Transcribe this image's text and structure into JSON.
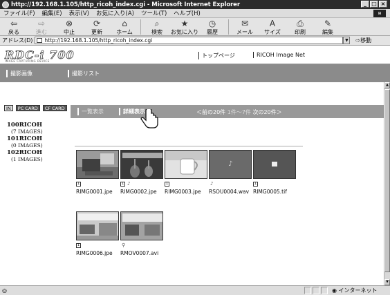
{
  "window": {
    "title": "http://192.168.1.105/http_ricoh_index.cgi - Microsoft Internet Explorer",
    "controls": [
      "_",
      "□",
      "×"
    ]
  },
  "menubar": {
    "items": [
      "ファイル(F)",
      "編集(E)",
      "表示(V)",
      "お気に入り(A)",
      "ツール(T)",
      "ヘルプ(H)"
    ]
  },
  "toolbar": {
    "buttons": [
      {
        "label": "戻る",
        "icon": "back-arrow-icon",
        "glyph": "⇦"
      },
      {
        "label": "進む",
        "icon": "forward-arrow-icon",
        "glyph": "⇨"
      },
      {
        "label": "中止",
        "icon": "stop-icon",
        "glyph": "⊗"
      },
      {
        "label": "更新",
        "icon": "refresh-icon",
        "glyph": "⟳"
      },
      {
        "label": "ホーム",
        "icon": "home-icon",
        "glyph": "⌂"
      },
      {
        "label": "検索",
        "icon": "search-icon",
        "glyph": "⌕"
      },
      {
        "label": "お気に入り",
        "icon": "favorites-icon",
        "glyph": "★"
      },
      {
        "label": "履歴",
        "icon": "history-icon",
        "glyph": "◷"
      },
      {
        "label": "メール",
        "icon": "mail-icon",
        "glyph": "✉"
      },
      {
        "label": "サイズ",
        "icon": "font-size-icon",
        "glyph": "A"
      },
      {
        "label": "印刷",
        "icon": "print-icon",
        "glyph": "⎙"
      },
      {
        "label": "編集",
        "icon": "edit-icon",
        "glyph": "✎"
      }
    ]
  },
  "addressbar": {
    "label": "アドレス(D)",
    "url": "http://192.168.1.105/http_ricoh_index.cgi",
    "go_label": "⇨移動"
  },
  "header": {
    "logo": "RDC-i 700",
    "logo_sub": "IMAGE CAPTURING DEVICE",
    "links": [
      "トップページ",
      "RICOH Image Net"
    ],
    "tabs": [
      "撮影画像",
      "撮影リスト"
    ]
  },
  "sidebar": {
    "modes": [
      "IN",
      "PC CARD",
      "CF CARD"
    ],
    "folders": [
      {
        "name": "100RICOH",
        "count": "(7 IMAGES)"
      },
      {
        "name": "101RICOH",
        "count": "(0 IMAGES)"
      },
      {
        "name": "102RICOH",
        "count": "(1 IMAGES)"
      }
    ]
  },
  "main": {
    "view_list": "一覧表示",
    "view_detail": "詳細表示",
    "nav_prev": "＜前の20件",
    "nav_range": "1件〜7件",
    "nav_next": "次の20件＞",
    "thumbnails": [
      {
        "file": "RIMG0001.jpe",
        "type": "photo",
        "mic": false
      },
      {
        "file": "RIMG0002.jpe",
        "type": "photo",
        "mic": true
      },
      {
        "file": "RIMG0003.jpe",
        "type": "photo",
        "mic": false
      },
      {
        "file": "RSOU0004.wav",
        "type": "sound",
        "mic": true
      },
      {
        "file": "RIMG0005.tif",
        "type": "tiff",
        "mic": false
      },
      {
        "file": "RIMG0006.jpe",
        "type": "photo",
        "mic": false
      },
      {
        "file": "RMOV0007.avi",
        "type": "movie",
        "mic": false
      }
    ]
  },
  "statusbar": {
    "left": "",
    "zone": "インターネット"
  }
}
